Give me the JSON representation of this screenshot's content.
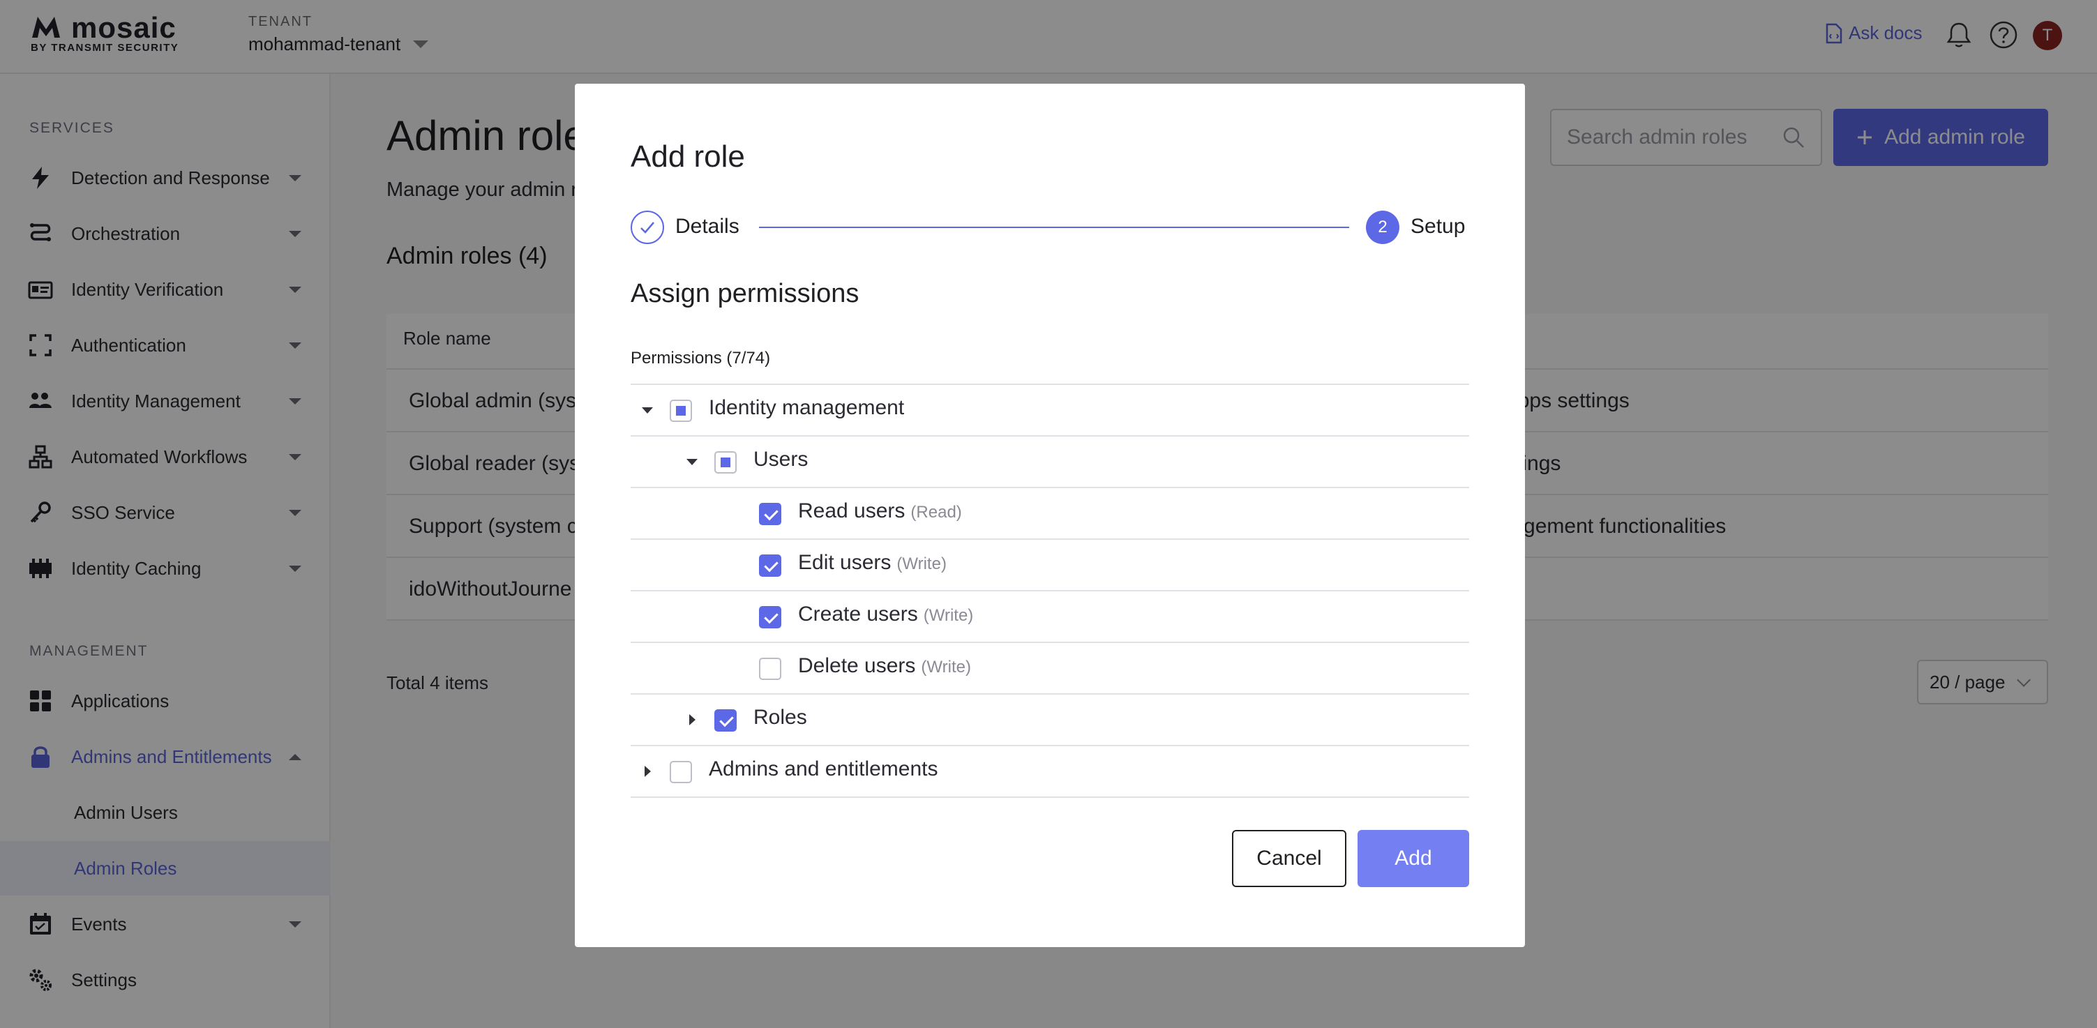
{
  "header": {
    "logo_word": "mosaic",
    "logo_sub": "BY TRANSMIT SECURITY",
    "tenant_label": "TENANT",
    "tenant_name": "mohammad-tenant",
    "ask_docs": "Ask docs",
    "avatar_initial": "T"
  },
  "sidebar": {
    "services_label": "SERVICES",
    "services": [
      {
        "label": "Detection and Response",
        "icon": "bolt-icon"
      },
      {
        "label": "Orchestration",
        "icon": "route-icon"
      },
      {
        "label": "Identity Verification",
        "icon": "id-card-icon"
      },
      {
        "label": "Authentication",
        "icon": "scan-frame-icon"
      },
      {
        "label": "Identity Management",
        "icon": "users-icon"
      },
      {
        "label": "Automated Workflows",
        "icon": "workflow-icon"
      },
      {
        "label": "SSO Service",
        "icon": "key-icon"
      },
      {
        "label": "Identity Caching",
        "icon": "cache-icon"
      }
    ],
    "management_label": "MANAGEMENT",
    "applications": "Applications",
    "admins_entitlements": "Admins and Entitlements",
    "admin_users": "Admin Users",
    "admin_roles": "Admin Roles",
    "events": "Events",
    "settings": "Settings"
  },
  "main": {
    "title": "Admin roles",
    "description": "Manage your admin roles",
    "section_title": "Admin roles (4)",
    "search_placeholder": "Search admin roles",
    "add_button": "Add admin role",
    "table": {
      "column_role_name": "Role name",
      "rows": [
        {
          "name": "Global admin (sys",
          "desc": "d apps settings"
        },
        {
          "name": "Global reader (sys",
          "desc": "settings"
        },
        {
          "name": "Support (system c",
          "desc": "anagement functionalities"
        },
        {
          "name": "idoWithoutJourne",
          "desc": ""
        }
      ]
    },
    "total": "Total 4 items",
    "page_size": "20 / page"
  },
  "modal": {
    "title": "Add role",
    "step1": "Details",
    "step2_number": "2",
    "step2": "Setup",
    "assign_title": "Assign permissions",
    "permissions_count": "Permissions (7/74)",
    "tree": {
      "identity_management": "Identity management",
      "users": "Users",
      "read_users": "Read users",
      "read_type": "(Read)",
      "edit_users": "Edit users",
      "edit_type": "(Write)",
      "create_users": "Create users",
      "create_type": "(Write)",
      "delete_users": "Delete users",
      "delete_type": "(Write)",
      "roles": "Roles",
      "admins_entitlements": "Admins and entitlements"
    },
    "cancel": "Cancel",
    "add": "Add"
  },
  "colors": {
    "accent": "#5d68e6",
    "accent_light": "#7480f2",
    "avatar_bg": "#8b2323",
    "link": "#5a63d9"
  }
}
